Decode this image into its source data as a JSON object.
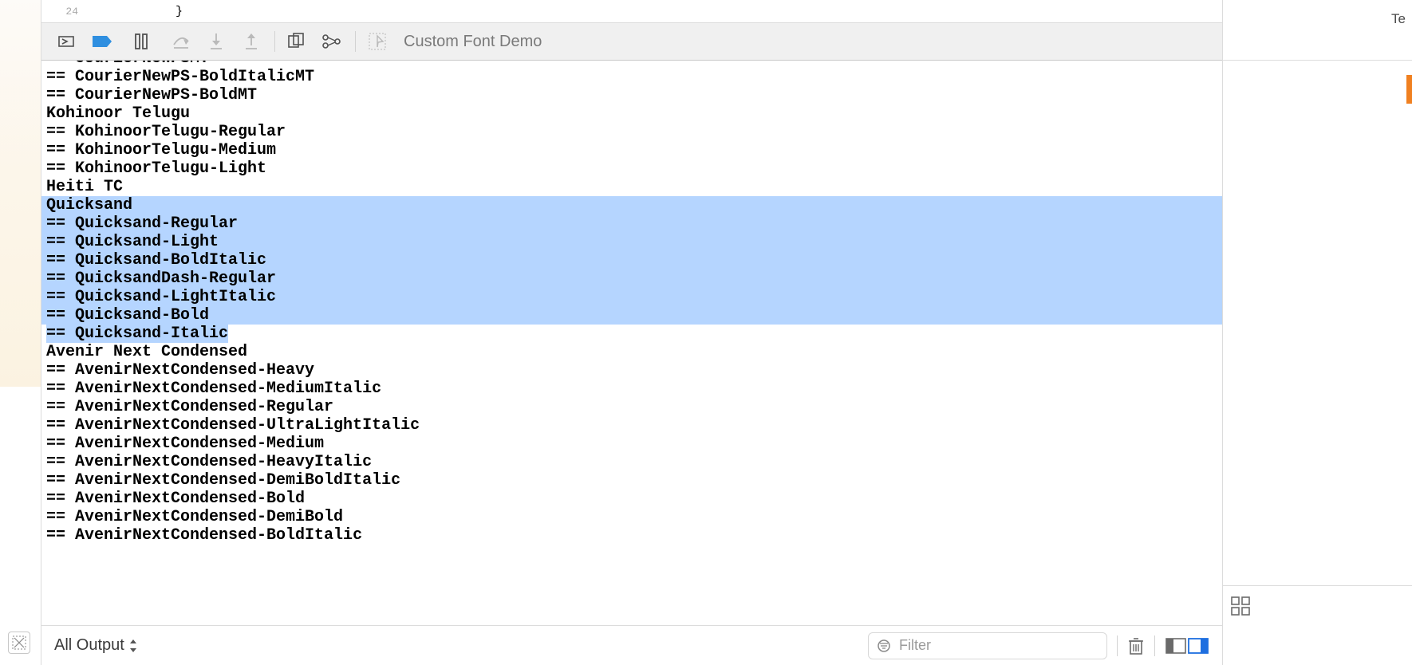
{
  "editor": {
    "line_no": "24",
    "code": "}"
  },
  "toolbar": {
    "title": "Custom Font Demo"
  },
  "console": {
    "lines": [
      {
        "text": "== CourierNewPSMT",
        "sel": false,
        "cut": "top"
      },
      {
        "text": "== CourierNewPS-BoldItalicMT",
        "sel": false
      },
      {
        "text": "== CourierNewPS-BoldMT",
        "sel": false
      },
      {
        "text": "Kohinoor Telugu",
        "sel": false
      },
      {
        "text": "== KohinoorTelugu-Regular",
        "sel": false
      },
      {
        "text": "== KohinoorTelugu-Medium",
        "sel": false
      },
      {
        "text": "== KohinoorTelugu-Light",
        "sel": false
      },
      {
        "text": "Heiti TC",
        "sel": false
      },
      {
        "text": "Quicksand",
        "sel": true
      },
      {
        "text": "== Quicksand-Regular",
        "sel": true
      },
      {
        "text": "== Quicksand-Light",
        "sel": true
      },
      {
        "text": "== Quicksand-BoldItalic",
        "sel": true
      },
      {
        "text": "== QuicksandDash-Regular",
        "sel": true
      },
      {
        "text": "== Quicksand-LightItalic",
        "sel": true
      },
      {
        "text": "== Quicksand-Bold",
        "sel": true
      },
      {
        "text": "== Quicksand-Italic",
        "sel": "partial"
      },
      {
        "text": "Avenir Next Condensed",
        "sel": false
      },
      {
        "text": "== AvenirNextCondensed-Heavy",
        "sel": false
      },
      {
        "text": "== AvenirNextCondensed-MediumItalic",
        "sel": false
      },
      {
        "text": "== AvenirNextCondensed-Regular",
        "sel": false
      },
      {
        "text": "== AvenirNextCondensed-UltraLightItalic",
        "sel": false
      },
      {
        "text": "== AvenirNextCondensed-Medium",
        "sel": false
      },
      {
        "text": "== AvenirNextCondensed-HeavyItalic",
        "sel": false
      },
      {
        "text": "== AvenirNextCondensed-DemiBoldItalic",
        "sel": false
      },
      {
        "text": "== AvenirNextCondensed-Bold",
        "sel": false
      },
      {
        "text": "== AvenirNextCondensed-DemiBold",
        "sel": false
      },
      {
        "text": "== AvenirNextCondensed-BoldItalic",
        "sel": false,
        "cut": "bot"
      }
    ]
  },
  "bottom": {
    "output_label": "All Output",
    "filter_placeholder": "Filter"
  },
  "right": {
    "top_label": "Te"
  }
}
